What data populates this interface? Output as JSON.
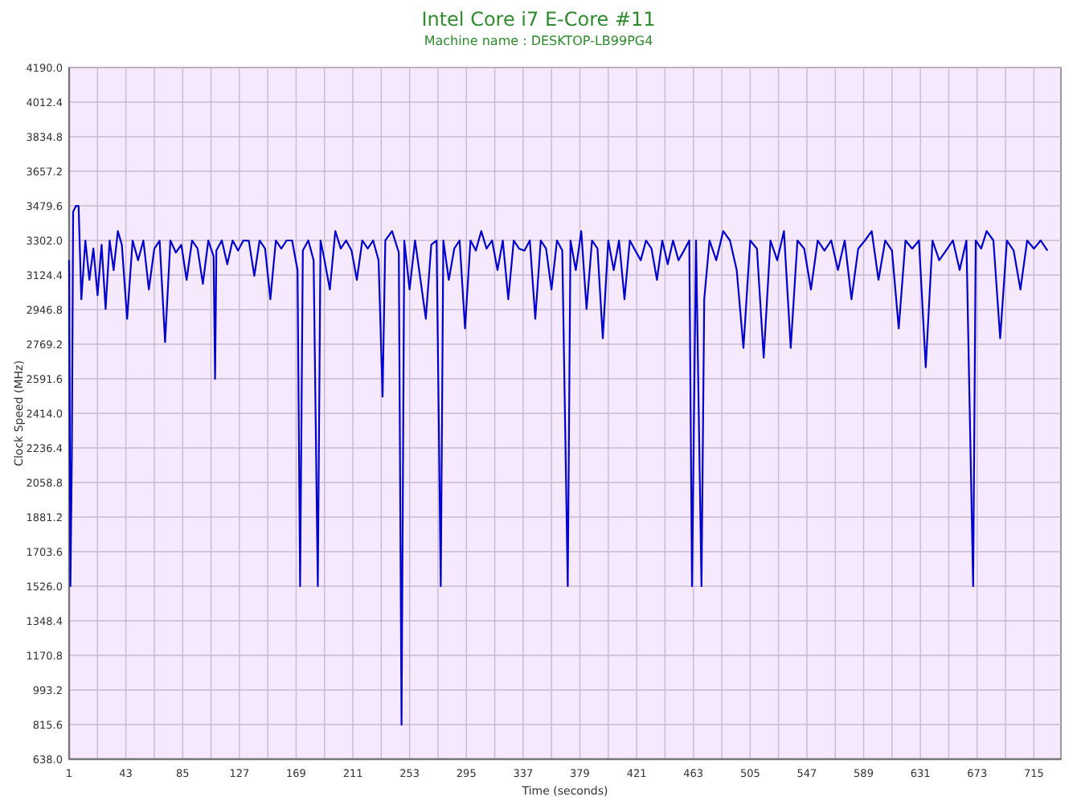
{
  "title": "Intel Core i7 E-Core #11",
  "subtitle": "Machine name : DESKTOP-LB99PG4",
  "chart_data": {
    "type": "line",
    "xlabel": "Time (seconds)",
    "ylabel": "Clock Speed (MHz)",
    "grid": true,
    "xlim": [
      1,
      735
    ],
    "ylim": [
      638,
      4190
    ],
    "xticks": [
      1,
      43,
      85,
      127,
      169,
      211,
      253,
      295,
      337,
      379,
      421,
      463,
      505,
      547,
      589,
      631,
      673,
      715
    ],
    "yticks": [
      {
        "value": 638,
        "label": "638.0"
      },
      {
        "value": 815.6,
        "label": "815.6"
      },
      {
        "value": 993.2,
        "label": "993.2"
      },
      {
        "value": 1170.8,
        "label": "1170.8"
      },
      {
        "value": 1348.4,
        "label": "1348.4"
      },
      {
        "value": 1526,
        "label": "1526.0"
      },
      {
        "value": 1703.6,
        "label": "1703.6"
      },
      {
        "value": 1881.2,
        "label": "1881.2"
      },
      {
        "value": 2058.8,
        "label": "2058.8"
      },
      {
        "value": 2236.4,
        "label": "2236.4"
      },
      {
        "value": 2414,
        "label": "2414.0"
      },
      {
        "value": 2591.6,
        "label": "2591.6"
      },
      {
        "value": 2769.2,
        "label": "2769.2"
      },
      {
        "value": 2946.8,
        "label": "2946.8"
      },
      {
        "value": 3124.4,
        "label": "3124.4"
      },
      {
        "value": 3302,
        "label": "3302.0"
      },
      {
        "value": 3479.6,
        "label": "3479.6"
      },
      {
        "value": 3657.2,
        "label": "3657.2"
      },
      {
        "value": 3834.8,
        "label": "3834.8"
      },
      {
        "value": 4012.4,
        "label": "4012.4"
      },
      {
        "value": 4190,
        "label": "4190.0"
      }
    ],
    "x": [
      1,
      2,
      3,
      4,
      6,
      8,
      10,
      13,
      16,
      19,
      22,
      25,
      28,
      31,
      34,
      37,
      40,
      44,
      48,
      52,
      56,
      60,
      64,
      68,
      72,
      76,
      80,
      84,
      88,
      92,
      96,
      100,
      104,
      108,
      109,
      110,
      114,
      118,
      122,
      126,
      130,
      134,
      138,
      142,
      146,
      150,
      154,
      158,
      162,
      166,
      170,
      172,
      174,
      178,
      182,
      185,
      187,
      190,
      194,
      198,
      202,
      206,
      210,
      214,
      218,
      222,
      226,
      230,
      233,
      235,
      240,
      245,
      247,
      249,
      253,
      257,
      261,
      265,
      269,
      273,
      276,
      278,
      282,
      286,
      290,
      294,
      298,
      302,
      306,
      310,
      314,
      318,
      322,
      326,
      330,
      334,
      338,
      342,
      346,
      350,
      354,
      358,
      362,
      366,
      370,
      372,
      376,
      380,
      384,
      388,
      392,
      396,
      400,
      404,
      408,
      412,
      416,
      420,
      424,
      428,
      432,
      436,
      440,
      444,
      448,
      452,
      456,
      460,
      462,
      465,
      469,
      471,
      475,
      480,
      485,
      490,
      495,
      500,
      505,
      510,
      515,
      520,
      525,
      530,
      535,
      540,
      545,
      550,
      555,
      560,
      565,
      570,
      575,
      580,
      585,
      590,
      595,
      600,
      605,
      610,
      615,
      620,
      625,
      630,
      635,
      640,
      645,
      650,
      655,
      660,
      665,
      670,
      672,
      676,
      680,
      685,
      690,
      695,
      700,
      705,
      710,
      715,
      720,
      725
    ],
    "series": [
      {
        "color": "#0000cc",
        "values": [
          3200,
          1526,
          2200,
          3450,
          3479,
          3479,
          3000,
          3302,
          3100,
          3260,
          3020,
          3280,
          2950,
          3302,
          3150,
          3350,
          3280,
          2900,
          3302,
          3200,
          3302,
          3050,
          3260,
          3300,
          2780,
          3302,
          3240,
          3280,
          3100,
          3302,
          3260,
          3080,
          3302,
          3220,
          2591,
          3250,
          3302,
          3180,
          3302,
          3250,
          3302,
          3300,
          3120,
          3302,
          3260,
          3000,
          3302,
          3260,
          3302,
          3302,
          3150,
          1526,
          3250,
          3302,
          3200,
          1526,
          3302,
          3200,
          3050,
          3350,
          3260,
          3302,
          3250,
          3100,
          3302,
          3260,
          3302,
          3200,
          2500,
          3302,
          3350,
          3240,
          815,
          3300,
          3050,
          3302,
          3100,
          2900,
          3280,
          3302,
          1526,
          3302,
          3100,
          3260,
          3302,
          2850,
          3302,
          3250,
          3350,
          3260,
          3302,
          3150,
          3302,
          3000,
          3302,
          3260,
          3250,
          3302,
          2900,
          3302,
          3260,
          3050,
          3302,
          3250,
          1526,
          3302,
          3150,
          3350,
          2950,
          3302,
          3260,
          2800,
          3302,
          3150,
          3302,
          3000,
          3302,
          3250,
          3200,
          3302,
          3260,
          3100,
          3302,
          3180,
          3302,
          3200,
          3250,
          3302,
          1526,
          3302,
          1526,
          3000,
          3302,
          3200,
          3350,
          3302,
          3150,
          2750,
          3302,
          3260,
          2700,
          3302,
          3200,
          3350,
          2750,
          3302,
          3260,
          3050,
          3302,
          3250,
          3302,
          3150,
          3302,
          3000,
          3260,
          3302,
          3350,
          3100,
          3302,
          3250,
          2850,
          3302,
          3260,
          3302,
          2650,
          3302,
          3200,
          3250,
          3302,
          3150,
          3302,
          1526,
          3302,
          3260,
          3350,
          3302,
          2800,
          3302,
          3250,
          3050,
          3302,
          3260,
          3302,
          3250
        ]
      }
    ]
  }
}
